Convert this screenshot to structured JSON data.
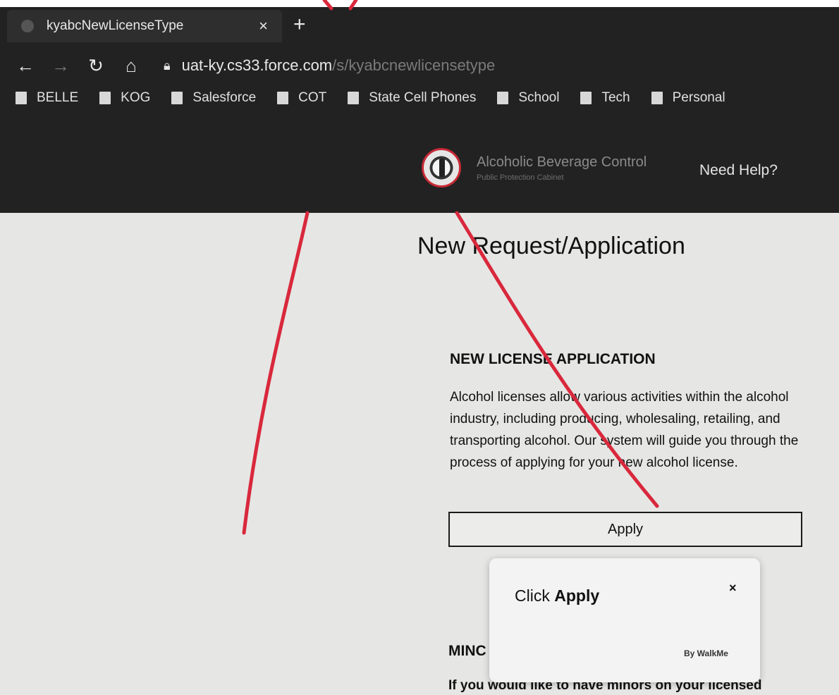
{
  "browser": {
    "tab_title": "kyabcNewLicenseType",
    "tab_close": "×",
    "new_tab": "+",
    "url_host": "uat-ky.cs33.force.com",
    "url_path": "/s/kyabcnewlicensetype",
    "bookmarks": [
      "BELLE",
      "KOG",
      "Salesforce",
      "COT",
      "State Cell Phones",
      "School",
      "Tech",
      "Personal"
    ]
  },
  "header": {
    "brand_name": "Alcoholic Beverage Control",
    "brand_sub": "Public Protection Cabinet",
    "need_help": "Need Help?"
  },
  "main": {
    "page_title": "New Request/Application",
    "section": {
      "heading": "NEW LICENSE APPLICATION",
      "body": "Alcohol licenses allow various activities within the alcohol industry, including producing, wholesaling, retailing, and transporting alcohol. Our system will guide you through the process of applying for your new alcohol license.",
      "button_label": "Apply"
    },
    "minors": {
      "heading": "MINC",
      "body": "If you would like to have minors on your licensed"
    }
  },
  "popup": {
    "text_prefix": "Click ",
    "text_bold": "Apply",
    "close": "×",
    "by": "By WalkMe"
  },
  "colors": {
    "chrome_bg": "#222222",
    "page_bg": "#e6e6e4",
    "annotation_red": "#d9283c"
  }
}
